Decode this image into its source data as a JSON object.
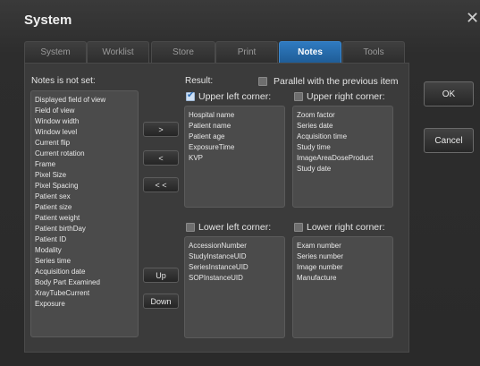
{
  "window": {
    "title": "System",
    "close_glyph": "✕"
  },
  "tabs": [
    {
      "label": "System",
      "active": false
    },
    {
      "label": "Worklist",
      "active": false
    },
    {
      "label": "Store",
      "active": false
    },
    {
      "label": "Print",
      "active": false
    },
    {
      "label": "Notes",
      "active": true
    },
    {
      "label": "Tools",
      "active": false
    }
  ],
  "notes_not_set": {
    "label": "Notes is not set:",
    "items": [
      "Displayed field of view",
      "Field of view",
      "Window width",
      "Window level",
      "Current flip",
      "Current rotation",
      "Frame",
      "Pixel Size",
      "Pixel Spacing",
      "Patient sex",
      "Patient size",
      "Patient weight",
      "Patient birthDay",
      "Patient ID",
      "Modality",
      "Series time",
      "Acquisition date",
      "Body Part Examined",
      "XrayTubeCurrent",
      "Exposure"
    ]
  },
  "move_buttons": {
    "add": ">",
    "remove": "<",
    "remove_all": "< <",
    "up": "Up",
    "down": "Down"
  },
  "result": {
    "label": "Result:",
    "parallel_label": "Parallel with the previous item",
    "parallel_checked": false
  },
  "corners": {
    "upper_left": {
      "label": "Upper left corner:",
      "checked": true,
      "items": [
        "Hospital name",
        "Patient name",
        "Patient age",
        "ExposureTime",
        "KVP"
      ]
    },
    "upper_right": {
      "label": "Upper right corner:",
      "checked": false,
      "items": [
        "Zoom factor",
        "Series date",
        "Acquisition time",
        "Study time",
        "ImageAreaDoseProduct",
        "Study date"
      ]
    },
    "lower_left": {
      "label": "Lower left corner:",
      "checked": false,
      "items": [
        "AccessionNumber",
        "StudyInstanceUID",
        "SeriesInstanceUID",
        "SOPInstanceUID"
      ]
    },
    "lower_right": {
      "label": "Lower right corner:",
      "checked": false,
      "items": [
        "Exam number",
        "Series number",
        "Image number",
        "Manufacture"
      ]
    }
  },
  "actions": {
    "ok": "OK",
    "cancel": "Cancel"
  }
}
